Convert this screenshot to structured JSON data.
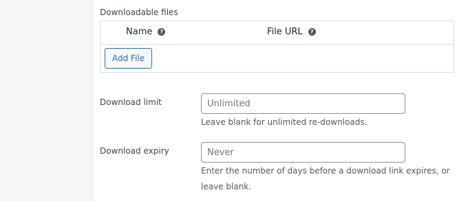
{
  "downloadable_files": {
    "label": "Downloadable files",
    "columns": {
      "name": "Name",
      "file_url": "File URL"
    },
    "add_file_label": "Add File"
  },
  "download_limit": {
    "label": "Download limit",
    "value": "",
    "placeholder": "Unlimited",
    "description": "Leave blank for unlimited re-downloads."
  },
  "download_expiry": {
    "label": "Download expiry",
    "value": "",
    "placeholder": "Never",
    "description_line1": "Enter the number of days before a download link expires, or",
    "description_line2": "leave blank."
  },
  "colors": {
    "accent": "#2271b1",
    "help_icon": "#50575e",
    "gutter": "#f6f7f7",
    "border": "#dcdcde"
  },
  "icons": {
    "help": "question-circle-icon"
  }
}
